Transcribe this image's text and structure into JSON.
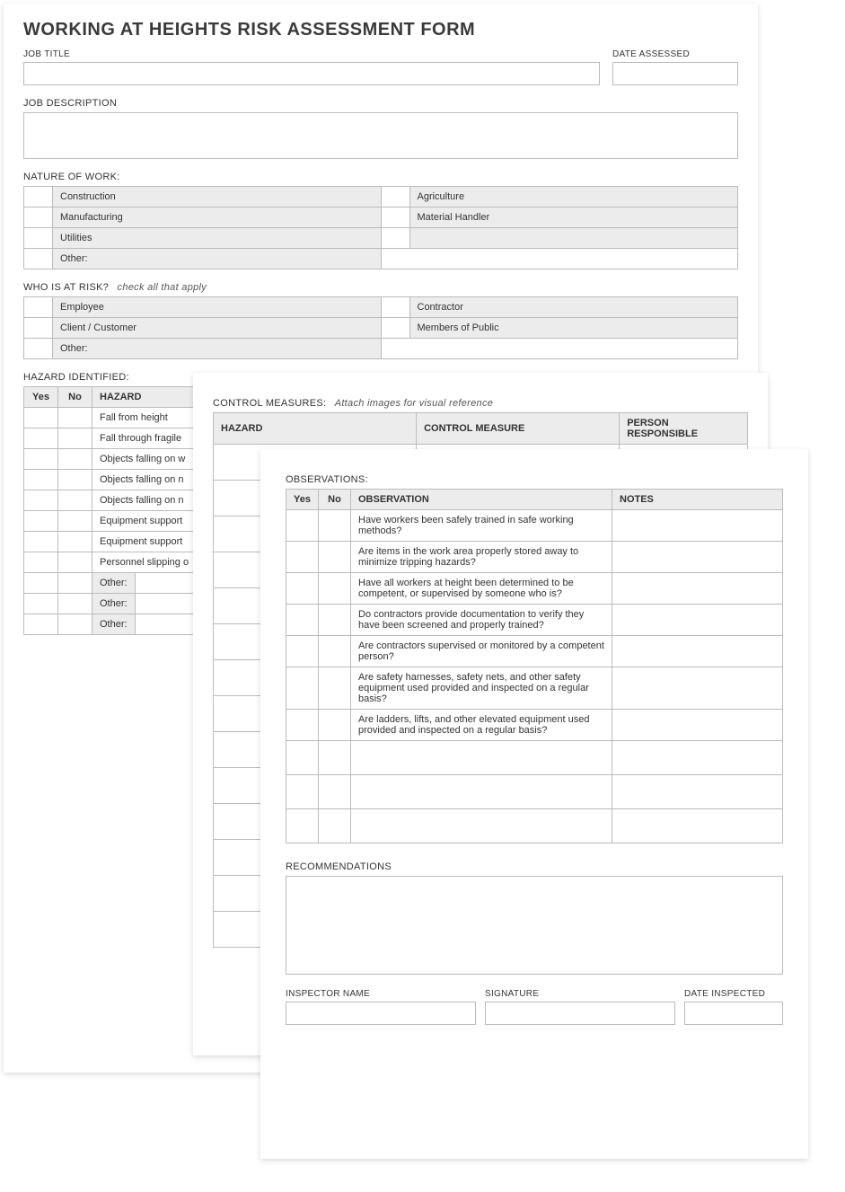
{
  "page1": {
    "title": "WORKING AT HEIGHTS RISK ASSESSMENT FORM",
    "job_title_label": "JOB TITLE",
    "date_assessed_label": "DATE ASSESSED",
    "job_description_label": "JOB DESCRIPTION",
    "nature_label": "NATURE OF WORK:",
    "nature_rows": [
      [
        "Construction",
        "Agriculture"
      ],
      [
        "Manufacturing",
        "Material Handler"
      ],
      [
        "Utilities",
        ""
      ]
    ],
    "nature_other_label": "Other:",
    "risk_label": "WHO IS AT RISK?",
    "risk_hint": "check all that apply",
    "risk_rows": [
      [
        "Employee",
        "Contractor"
      ],
      [
        "Client / Customer",
        "Members of Public"
      ]
    ],
    "risk_other_label": "Other:",
    "hazard_label": "HAZARD IDENTIFIED:",
    "hazard_headers": {
      "yes": "Yes",
      "no": "No",
      "hazard": "HAZARD"
    },
    "hazards": [
      "Fall from height",
      "Fall through fragile",
      "Objects falling on w",
      "Objects falling on n",
      "Objects falling on n",
      "Equipment support",
      "Equipment support",
      "Personnel slipping o"
    ],
    "hazard_others": [
      "Other:",
      "Other:",
      "Other:"
    ]
  },
  "page2": {
    "control_label": "CONTROL MEASURES:",
    "control_hint": "Attach images for visual reference",
    "control_headers": {
      "hazard": "HAZARD",
      "measure": "CONTROL MEASURE",
      "person": "PERSON RESPONSIBLE"
    }
  },
  "page3": {
    "obs_label": "OBSERVATIONS:",
    "obs_headers": {
      "yes": "Yes",
      "no": "No",
      "obs": "OBSERVATION",
      "notes": "NOTES"
    },
    "observations": [
      "Have workers been safely trained in safe working methods?",
      "Are items in the work area properly stored away to minimize tripping hazards?",
      "Have all workers at height been determined to be competent, or supervised by someone who is?",
      "Do contractors provide documentation to verify they have been screened and properly trained?",
      "Are contractors supervised or monitored by a competent person?",
      "Are safety harnesses, safety nets, and other safety equipment used provided and inspected on a regular basis?",
      "Are ladders, lifts, and other elevated equipment used provided and inspected on a regular basis?"
    ],
    "rec_label": "RECOMMENDATIONS",
    "inspector_label": "INSPECTOR NAME",
    "signature_label": "SIGNATURE",
    "date_inspected_label": "DATE INSPECTED"
  }
}
